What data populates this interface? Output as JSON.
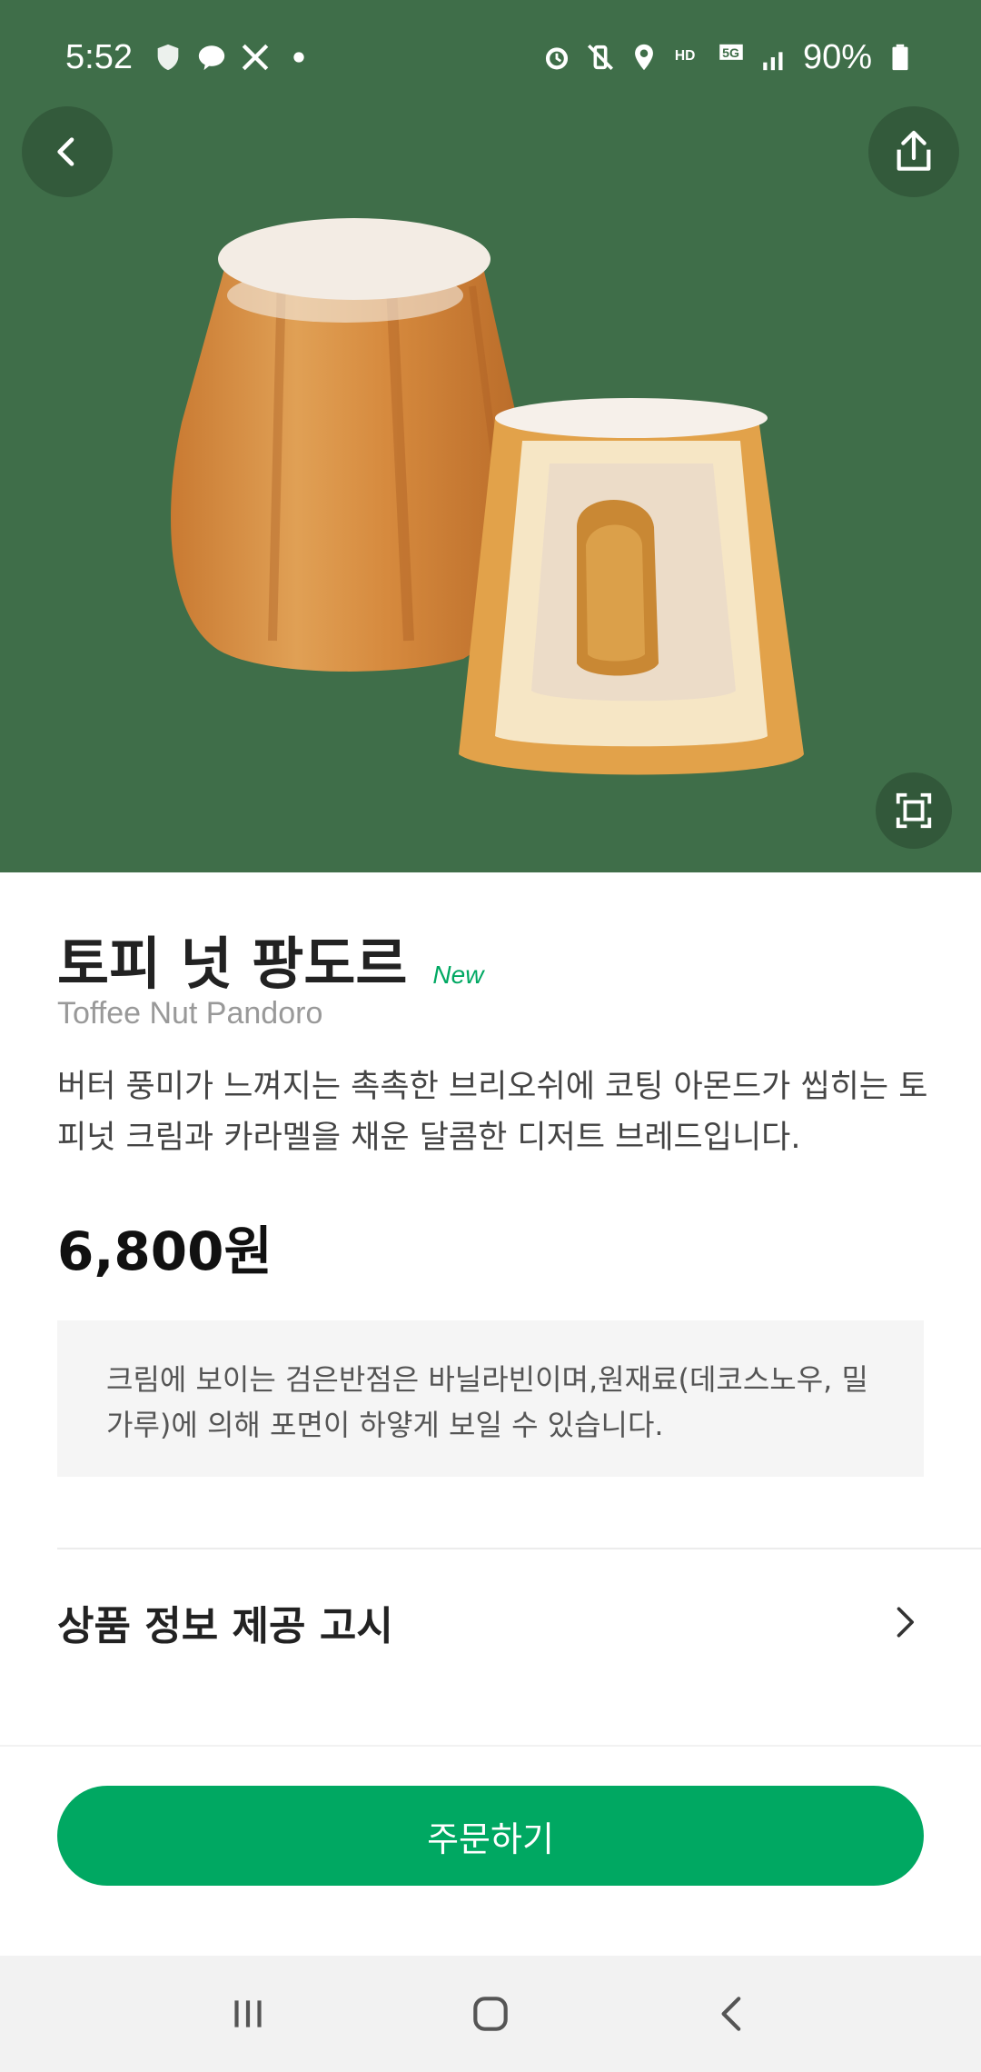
{
  "status_bar": {
    "time": "5:52",
    "battery": "90%",
    "left_icons": [
      "shield-icon",
      "kakaotalk-icon",
      "x-icon",
      "dot-icon"
    ],
    "right_icons": [
      "alarm-icon",
      "vibrate-icon",
      "location-icon",
      "hd-voice-icon",
      "5g-icon",
      "signal-icon",
      "battery-icon"
    ]
  },
  "product": {
    "name_ko": "토피 넛 팡도르",
    "badge": "New",
    "name_en": "Toffee Nut Pandoro",
    "description": "버터 풍미가 느껴지는 촉촉한 브리오쉬에 코팅 아몬드가 씹히는 토피넛 크림과 카라멜을 채운 달콤한 디저트 브레드입니다.",
    "price": "6,800원",
    "notice": "크림에 보이는 검은반점은 바닐라빈이며,원재료(데코스노우, 밀가루)에 의해 포면이 하얗게 보일 수 있습니다."
  },
  "info_section": {
    "label": "상품 정보 제공 고시"
  },
  "actions": {
    "order_label": "주문하기"
  },
  "colors": {
    "hero_bg": "#3f6e49",
    "brand_green": "#00a862",
    "notice_bg": "#f5f5f5"
  }
}
